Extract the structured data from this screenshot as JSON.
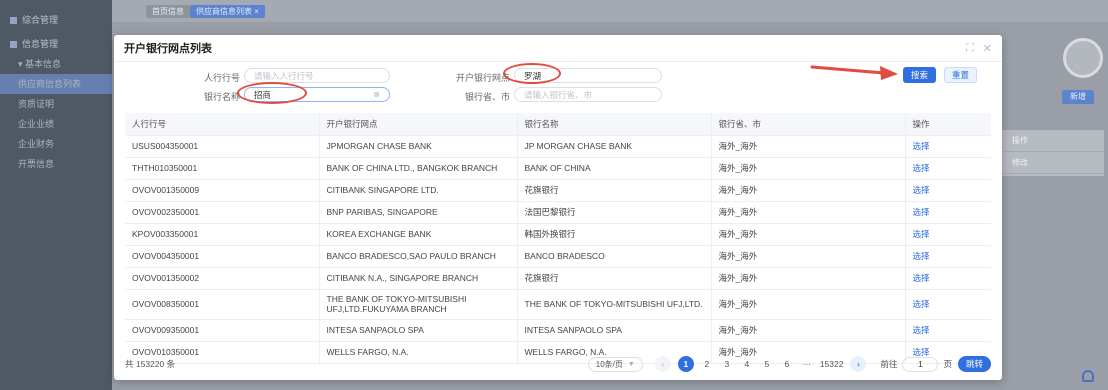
{
  "background": {
    "sidebar": [
      {
        "label": "综合管理",
        "kind": "group"
      },
      {
        "label": "信息管理",
        "kind": "group"
      },
      {
        "label": "▾ 基本信息",
        "kind": "sub"
      },
      {
        "label": "供应商信息列表",
        "kind": "sub",
        "active": true
      },
      {
        "label": "资质证明",
        "kind": "sub"
      },
      {
        "label": "企业业绩",
        "kind": "sub"
      },
      {
        "label": "企业财务",
        "kind": "sub"
      },
      {
        "label": "开票信息",
        "kind": "sub"
      }
    ],
    "tabs": [
      "首页信息",
      "供应商信息列表 ×"
    ],
    "add_button": "新增",
    "table_cells": [
      "操作",
      "修改"
    ]
  },
  "dialog": {
    "title": "开户银行网点列表",
    "search": {
      "bank_no_label": "人行行号",
      "bank_no_placeholder": "请输入人行行号",
      "branch_label": "开户银行网点",
      "branch_value": "罗湖",
      "bank_name_label": "银行名称",
      "bank_name_value": "招商",
      "province_label": "银行省、市",
      "province_placeholder": "请输入银行省、市",
      "search_button": "搜索",
      "reset_button": "重置"
    },
    "table": {
      "headers": [
        "人行行号",
        "开户银行网点",
        "银行名称",
        "银行省、市",
        "操作"
      ],
      "rows": [
        [
          "USUS004350001",
          "JPMORGAN CHASE BANK",
          "JP MORGAN CHASE BANK",
          "海外_海外",
          "选择"
        ],
        [
          "THTH010350001",
          "BANK OF CHINA LTD., BANGKOK BRANCH",
          "BANK OF CHINA",
          "海外_海外",
          "选择"
        ],
        [
          "OVOV001350009",
          "CITIBANK SINGAPORE LTD.",
          "花旗银行",
          "海外_海外",
          "选择"
        ],
        [
          "OVOV002350001",
          "BNP PARIBAS, SINGAPORE",
          "法国巴黎银行",
          "海外_海外",
          "选择"
        ],
        [
          "KPOV003350001",
          "KOREA EXCHANGE BANK",
          "韩国外换银行",
          "海外_海外",
          "选择"
        ],
        [
          "OVOV004350001",
          "BANCO BRADESCO,SAO PAULO BRANCH",
          "BANCO BRADESCO",
          "海外_海外",
          "选择"
        ],
        [
          "OVOV001350002",
          "CITIBANK N.A., SINGAPORE BRANCH",
          "花旗银行",
          "海外_海外",
          "选择"
        ],
        [
          "OVOV008350001",
          "THE BANK OF TOKYO-MITSUBISHI UFJ,LTD.FUKUYAMA BRANCH",
          "THE BANK OF TOKYO-MITSUBISHI UFJ,LTD.",
          "海外_海外",
          "选择"
        ],
        [
          "OVOV009350001",
          "INTESA SANPAOLO SPA",
          "INTESA SANPAOLO SPA",
          "海外_海外",
          "选择"
        ],
        [
          "OVOV010350001",
          "WELLS FARGO, N.A.",
          "WELLS FARGO, N.A.",
          "海外_海外",
          "选择"
        ]
      ]
    },
    "pagination": {
      "total": "共 153220 条",
      "page_size": "10条/页",
      "pages": [
        "1",
        "2",
        "3",
        "4",
        "5",
        "6",
        "···",
        "15322"
      ],
      "current": "1",
      "goto_label": "前往",
      "goto_value": "1",
      "goto_unit": "页",
      "goto_button": "跳转"
    }
  },
  "annotation_color": "#e24b3f",
  "accent_color": "#2f6fe0"
}
